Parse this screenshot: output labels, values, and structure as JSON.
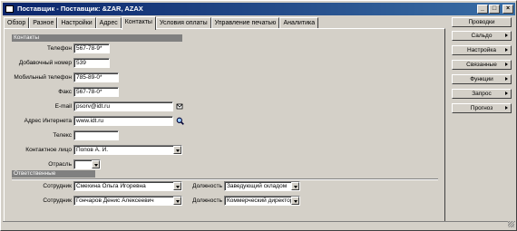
{
  "window": {
    "title": "Поставщик - Поставщик: &ZAR, AZAX",
    "buttons": [
      "_",
      "□",
      "×"
    ]
  },
  "tabs": [
    {
      "label": "Обзор"
    },
    {
      "label": "Разное"
    },
    {
      "label": "Настройки"
    },
    {
      "label": "Адрес"
    },
    {
      "label": "Контакты"
    },
    {
      "label": "Условия оплаты"
    },
    {
      "label": "Управление печатью"
    },
    {
      "label": "Аналитика"
    }
  ],
  "contacts": {
    "group_title": "Контакты",
    "phone_label": "Телефон",
    "phone_value": "567-78-9*",
    "ext_label": "Добавочный номер",
    "ext_value": "539",
    "mobile_label": "Мобильный телефон",
    "mobile_value": "785-89-0*",
    "fax_label": "Факс",
    "fax_value": "567-78-0*",
    "email_label": "E-mail",
    "email_value": "psorv@idt.ru",
    "web_label": "Адрес Интернета",
    "web_value": "www.idt.ru",
    "telex_label": "Телекс",
    "telex_value": "",
    "contact_person_label": "Контактное лицо",
    "contact_person_value": "Попов А. И.",
    "industry_label": "Отрасль",
    "industry_value": ""
  },
  "responsible": {
    "group_title": "Ответственные",
    "rows": [
      {
        "employee_label": "Сотрудник",
        "employee_value": "Смехина Ольга Игоревна",
        "position_label": "Должность",
        "position_value": "Заведующий складом"
      },
      {
        "employee_label": "Сотрудник",
        "employee_value": "Гончаров Денис Алексеевич",
        "position_label": "Должность",
        "position_value": "Коммерческий директор"
      }
    ]
  },
  "actions": [
    {
      "label": "Проводки",
      "submenu": false
    },
    {
      "label": "Сальдо",
      "submenu": true
    },
    {
      "label": "Настройка",
      "submenu": true
    },
    {
      "label": "Связанные",
      "submenu": true
    },
    {
      "label": "Функции",
      "submenu": true
    },
    {
      "label": "Запрос",
      "submenu": true
    },
    {
      "label": "Прогноз",
      "submenu": true
    }
  ]
}
